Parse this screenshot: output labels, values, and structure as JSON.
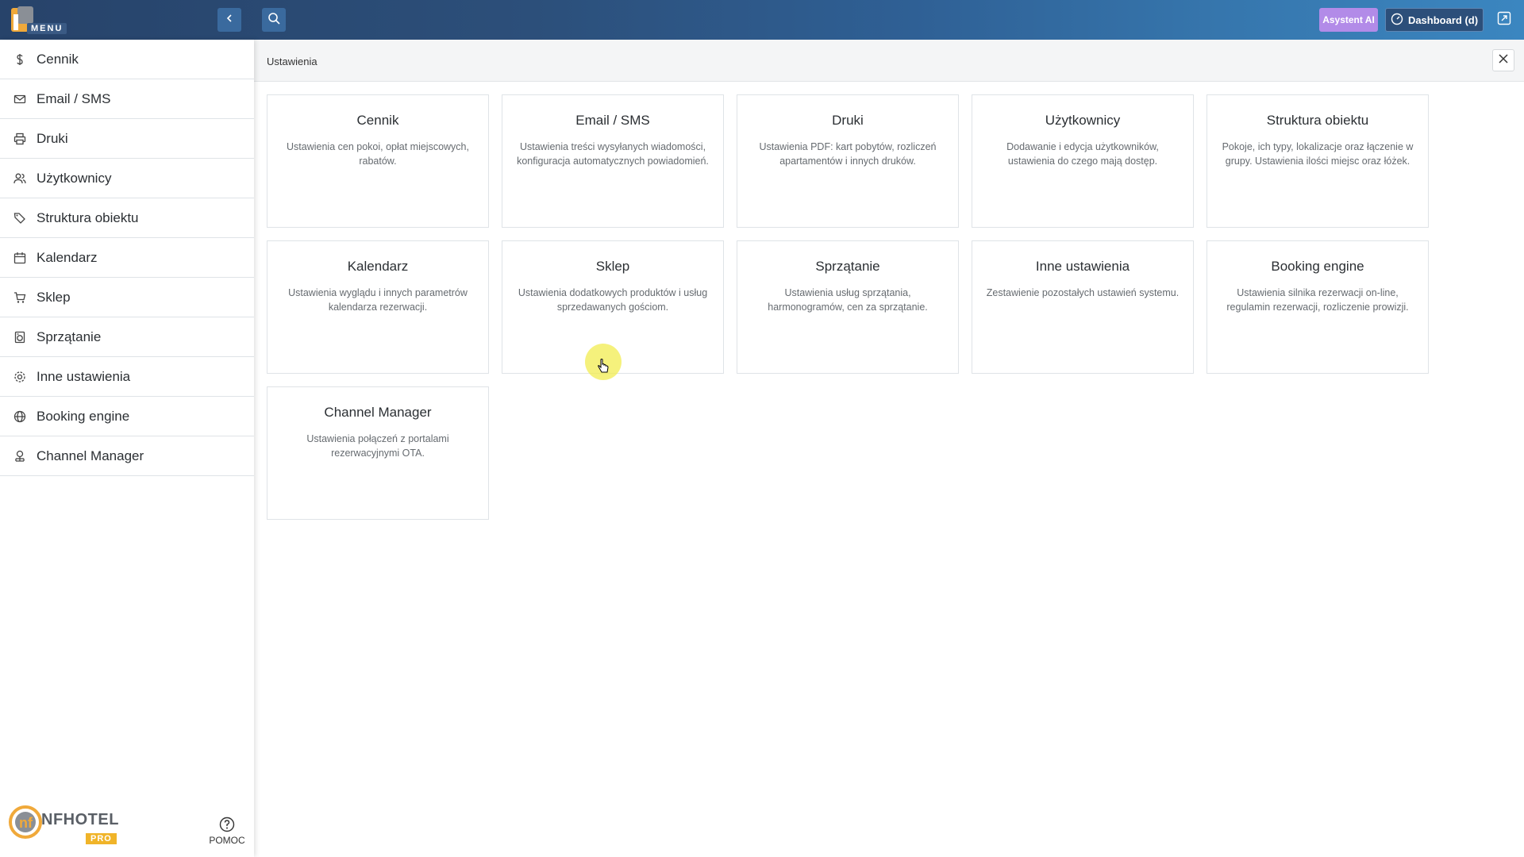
{
  "topbar": {
    "menu_label": "MENU",
    "ai_button": "Asystent AI",
    "dashboard_button": "Dashboard (d)",
    "accent_colors": {
      "ai": "#b28be8",
      "bar_start": "#27436a",
      "bar_end": "#3b86c0"
    }
  },
  "sidebar": {
    "items": [
      {
        "label": "Cennik",
        "icon": "dollar-icon"
      },
      {
        "label": "Email / SMS",
        "icon": "mail-icon"
      },
      {
        "label": "Druki",
        "icon": "printer-icon"
      },
      {
        "label": "Użytkownicy",
        "icon": "users-icon"
      },
      {
        "label": "Struktura obiektu",
        "icon": "tags-icon"
      },
      {
        "label": "Kalendarz",
        "icon": "calendar-icon"
      },
      {
        "label": "Sklep",
        "icon": "cart-icon"
      },
      {
        "label": "Sprzątanie",
        "icon": "washer-icon"
      },
      {
        "label": "Inne ustawienia",
        "icon": "gear-icon"
      },
      {
        "label": "Booking engine",
        "icon": "globe-icon"
      },
      {
        "label": "Channel Manager",
        "icon": "network-icon"
      }
    ],
    "brand_name": "NFHOTEL",
    "brand_tier": "PRO",
    "help_label": "POMOC"
  },
  "main": {
    "breadcrumb": "Ustawienia",
    "cards": [
      {
        "title": "Cennik",
        "desc": "Ustawienia cen pokoi, opłat miejscowych, rabatów."
      },
      {
        "title": "Email / SMS",
        "desc": "Ustawienia treści wysyłanych wiadomości, konfiguracja automatycznych powiadomień."
      },
      {
        "title": "Druki",
        "desc": "Ustawienia PDF: kart pobytów, rozliczeń apartamentów i innych druków."
      },
      {
        "title": "Użytkownicy",
        "desc": "Dodawanie i edycja użytkowników, ustawienia do czego mają dostęp."
      },
      {
        "title": "Struktura obiektu",
        "desc": "Pokoje, ich typy, lokalizacje oraz łączenie w grupy. Ustawienia ilości miejsc oraz łóżek."
      },
      {
        "title": "Kalendarz",
        "desc": "Ustawienia wyglądu i innych parametrów kalendarza rezerwacji."
      },
      {
        "title": "Sklep",
        "desc": "Ustawienia dodatkowych produktów i usług sprzedawanych gościom."
      },
      {
        "title": "Sprzątanie",
        "desc": "Ustawienia usług sprzątania, harmonogramów, cen za sprzątanie."
      },
      {
        "title": "Inne ustawienia",
        "desc": "Zestawienie pozostałych ustawień systemu."
      },
      {
        "title": "Booking engine",
        "desc": "Ustawienia silnika rezerwacji on-line, regulamin rezerwacji, rozliczenie prowizji."
      },
      {
        "title": "Channel Manager",
        "desc": "Ustawienia połączeń z portalami rezerwacyjnymi OTA."
      }
    ]
  }
}
